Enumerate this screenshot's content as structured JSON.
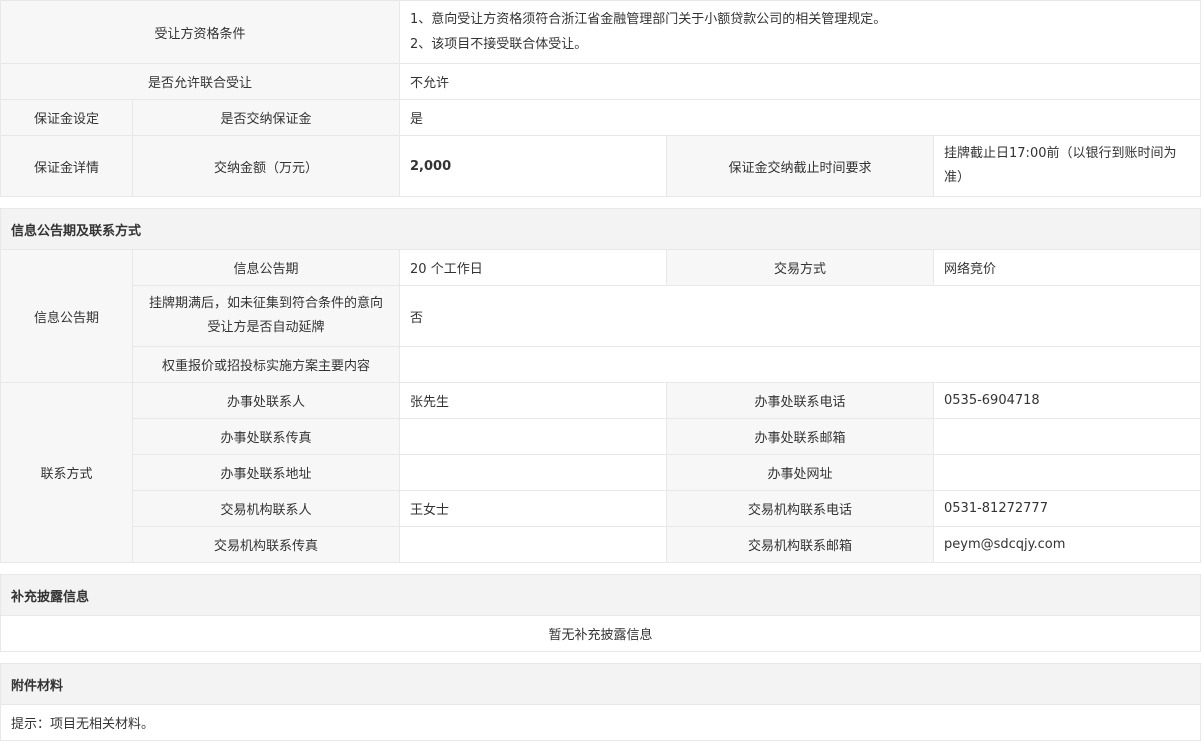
{
  "transferee": {
    "qualification_label": "受让方资格条件",
    "qualification_line1": "1、意向受让方资格须符合浙江省金融管理部门关于小额贷款公司的相关管理规定。",
    "qualification_line2": "2、该项目不接受联合体受让。",
    "consortium_label": "是否允许联合受让",
    "consortium_value": "不允许"
  },
  "deposit": {
    "setting_label": "保证金设定",
    "require_label": "是否交纳保证金",
    "require_value": "是",
    "detail_label": "保证金详情",
    "amount_label": "交纳金额（万元）",
    "amount_value": "2,000",
    "deadline_label": "保证金交纳截止时间要求",
    "deadline_value": "挂牌截止日17:00前（以银行到账时间为准）"
  },
  "announcement": {
    "section_title": "信息公告期及联系方式",
    "group_label": "信息公告期",
    "period_label": "信息公告期",
    "period_value": "20 个工作日",
    "method_label": "交易方式",
    "method_value": "网络竞价",
    "extend_label": "挂牌期满后，如未征集到符合条件的意向受让方是否自动延牌",
    "extend_value": "否",
    "weight_label": "权重报价或招投标实施方案主要内容",
    "weight_value": ""
  },
  "contact": {
    "group_label": "联系方式",
    "office_person_label": "办事处联系人",
    "office_person_value": "张先生",
    "office_phone_label": "办事处联系电话",
    "office_phone_value": "0535-6904718",
    "office_fax_label": "办事处联系传真",
    "office_fax_value": "",
    "office_email_label": "办事处联系邮箱",
    "office_email_value": "",
    "office_address_label": "办事处联系地址",
    "office_address_value": "",
    "office_website_label": "办事处网址",
    "office_website_value": "",
    "agency_person_label": "交易机构联系人",
    "agency_person_value": "王女士",
    "agency_phone_label": "交易机构联系电话",
    "agency_phone_value": "0531-81272777",
    "agency_fax_label": "交易机构联系传真",
    "agency_fax_value": "",
    "agency_email_label": "交易机构联系邮箱",
    "agency_email_value": "peym@sdcqjy.com"
  },
  "supplement": {
    "section_title": "补充披露信息",
    "empty_text": "暂无补充披露信息"
  },
  "attachments": {
    "section_title": "附件材料",
    "hint_text": "提示：项目无相关材料。"
  }
}
